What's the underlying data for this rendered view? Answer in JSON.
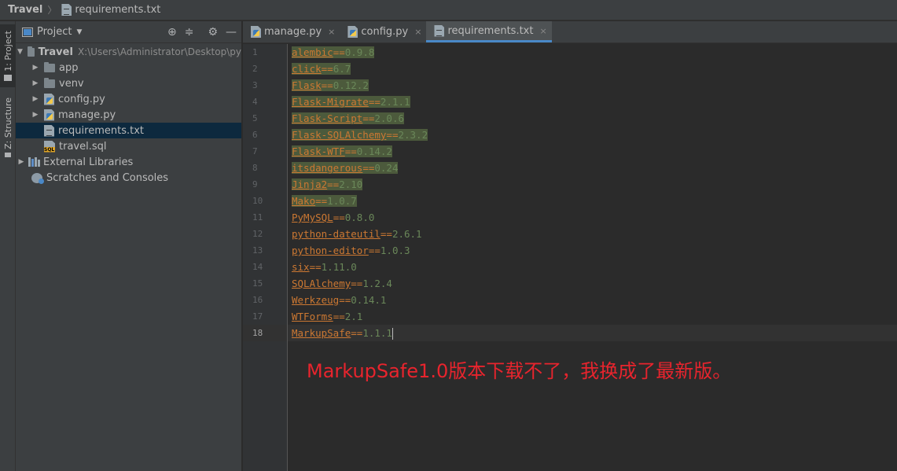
{
  "navbar": {
    "root": "Travel",
    "file": "requirements.txt"
  },
  "toolstrip": {
    "project_tab": "1: Project",
    "structure_tab": "Z: Structure"
  },
  "project_panel": {
    "title": "Project",
    "tools": {
      "locate": "⊕",
      "collapse": "≑",
      "settings": "⚙",
      "hide": "—"
    },
    "tree": {
      "root": {
        "label": "Travel",
        "path": "X:\\Users\\Administrator\\Desktop\\py"
      },
      "items": [
        {
          "label": "app",
          "kind": "folder"
        },
        {
          "label": "venv",
          "kind": "folder"
        },
        {
          "label": "config.py",
          "kind": "py"
        },
        {
          "label": "manage.py",
          "kind": "py"
        },
        {
          "label": "requirements.txt",
          "kind": "txt"
        },
        {
          "label": "travel.sql",
          "kind": "sql"
        }
      ],
      "external": "External Libraries",
      "scratches": "Scratches and Consoles"
    }
  },
  "tabs": [
    {
      "label": "manage.py",
      "close": "×"
    },
    {
      "label": "config.py",
      "close": "×"
    },
    {
      "label": "requirements.txt",
      "close": "×"
    }
  ],
  "editor": {
    "lines": [
      {
        "num": "1",
        "pkg": "alembic",
        "op": "==",
        "ver": "0.9.8"
      },
      {
        "num": "2",
        "pkg": "click",
        "op": "==",
        "ver": "6.7"
      },
      {
        "num": "3",
        "pkg": "Flask",
        "op": "==",
        "ver": "0.12.2"
      },
      {
        "num": "4",
        "pkg": "Flask-Migrate",
        "op": "==",
        "ver": "2.1.1"
      },
      {
        "num": "5",
        "pkg": "Flask-Script",
        "op": "==",
        "ver": "2.0.6"
      },
      {
        "num": "6",
        "pkg": "Flask-SQLAlchemy",
        "op": "==",
        "ver": "2.3.2"
      },
      {
        "num": "7",
        "pkg": "Flask-WTF",
        "op": "==",
        "ver": "0.14.2"
      },
      {
        "num": "8",
        "pkg": "itsdangerous",
        "op": "==",
        "ver": "0.24"
      },
      {
        "num": "9",
        "pkg": "Jinja2",
        "op": "==",
        "ver": "2.10"
      },
      {
        "num": "10",
        "pkg": "Mako",
        "op": "==",
        "ver": "1.0.7"
      },
      {
        "num": "11",
        "pkg": "PyMySQL",
        "op": "==",
        "ver": "0.8.0"
      },
      {
        "num": "12",
        "pkg": "python-dateutil",
        "op": "==",
        "ver": "2.6.1"
      },
      {
        "num": "13",
        "pkg": "python-editor",
        "op": "==",
        "ver": "1.0.3"
      },
      {
        "num": "14",
        "pkg": "six",
        "op": "==",
        "ver": "1.11.0"
      },
      {
        "num": "15",
        "pkg": "SQLAlchemy",
        "op": "==",
        "ver": "1.2.4"
      },
      {
        "num": "16",
        "pkg": "Werkzeug",
        "op": "==",
        "ver": "0.14.1"
      },
      {
        "num": "17",
        "pkg": "WTForms",
        "op": "==",
        "ver": "2.1"
      },
      {
        "num": "18",
        "pkg": "MarkupSafe",
        "op": "==",
        "ver": "1.1.1"
      }
    ]
  },
  "annotation": "MarkupSafe1.0版本下载不了，我换成了最新版。",
  "colors": {
    "package": "#cc7832",
    "version": "#6a8759",
    "annotation": "#e8242d",
    "selection": "#0d293e",
    "accent": "#4a88c7"
  }
}
